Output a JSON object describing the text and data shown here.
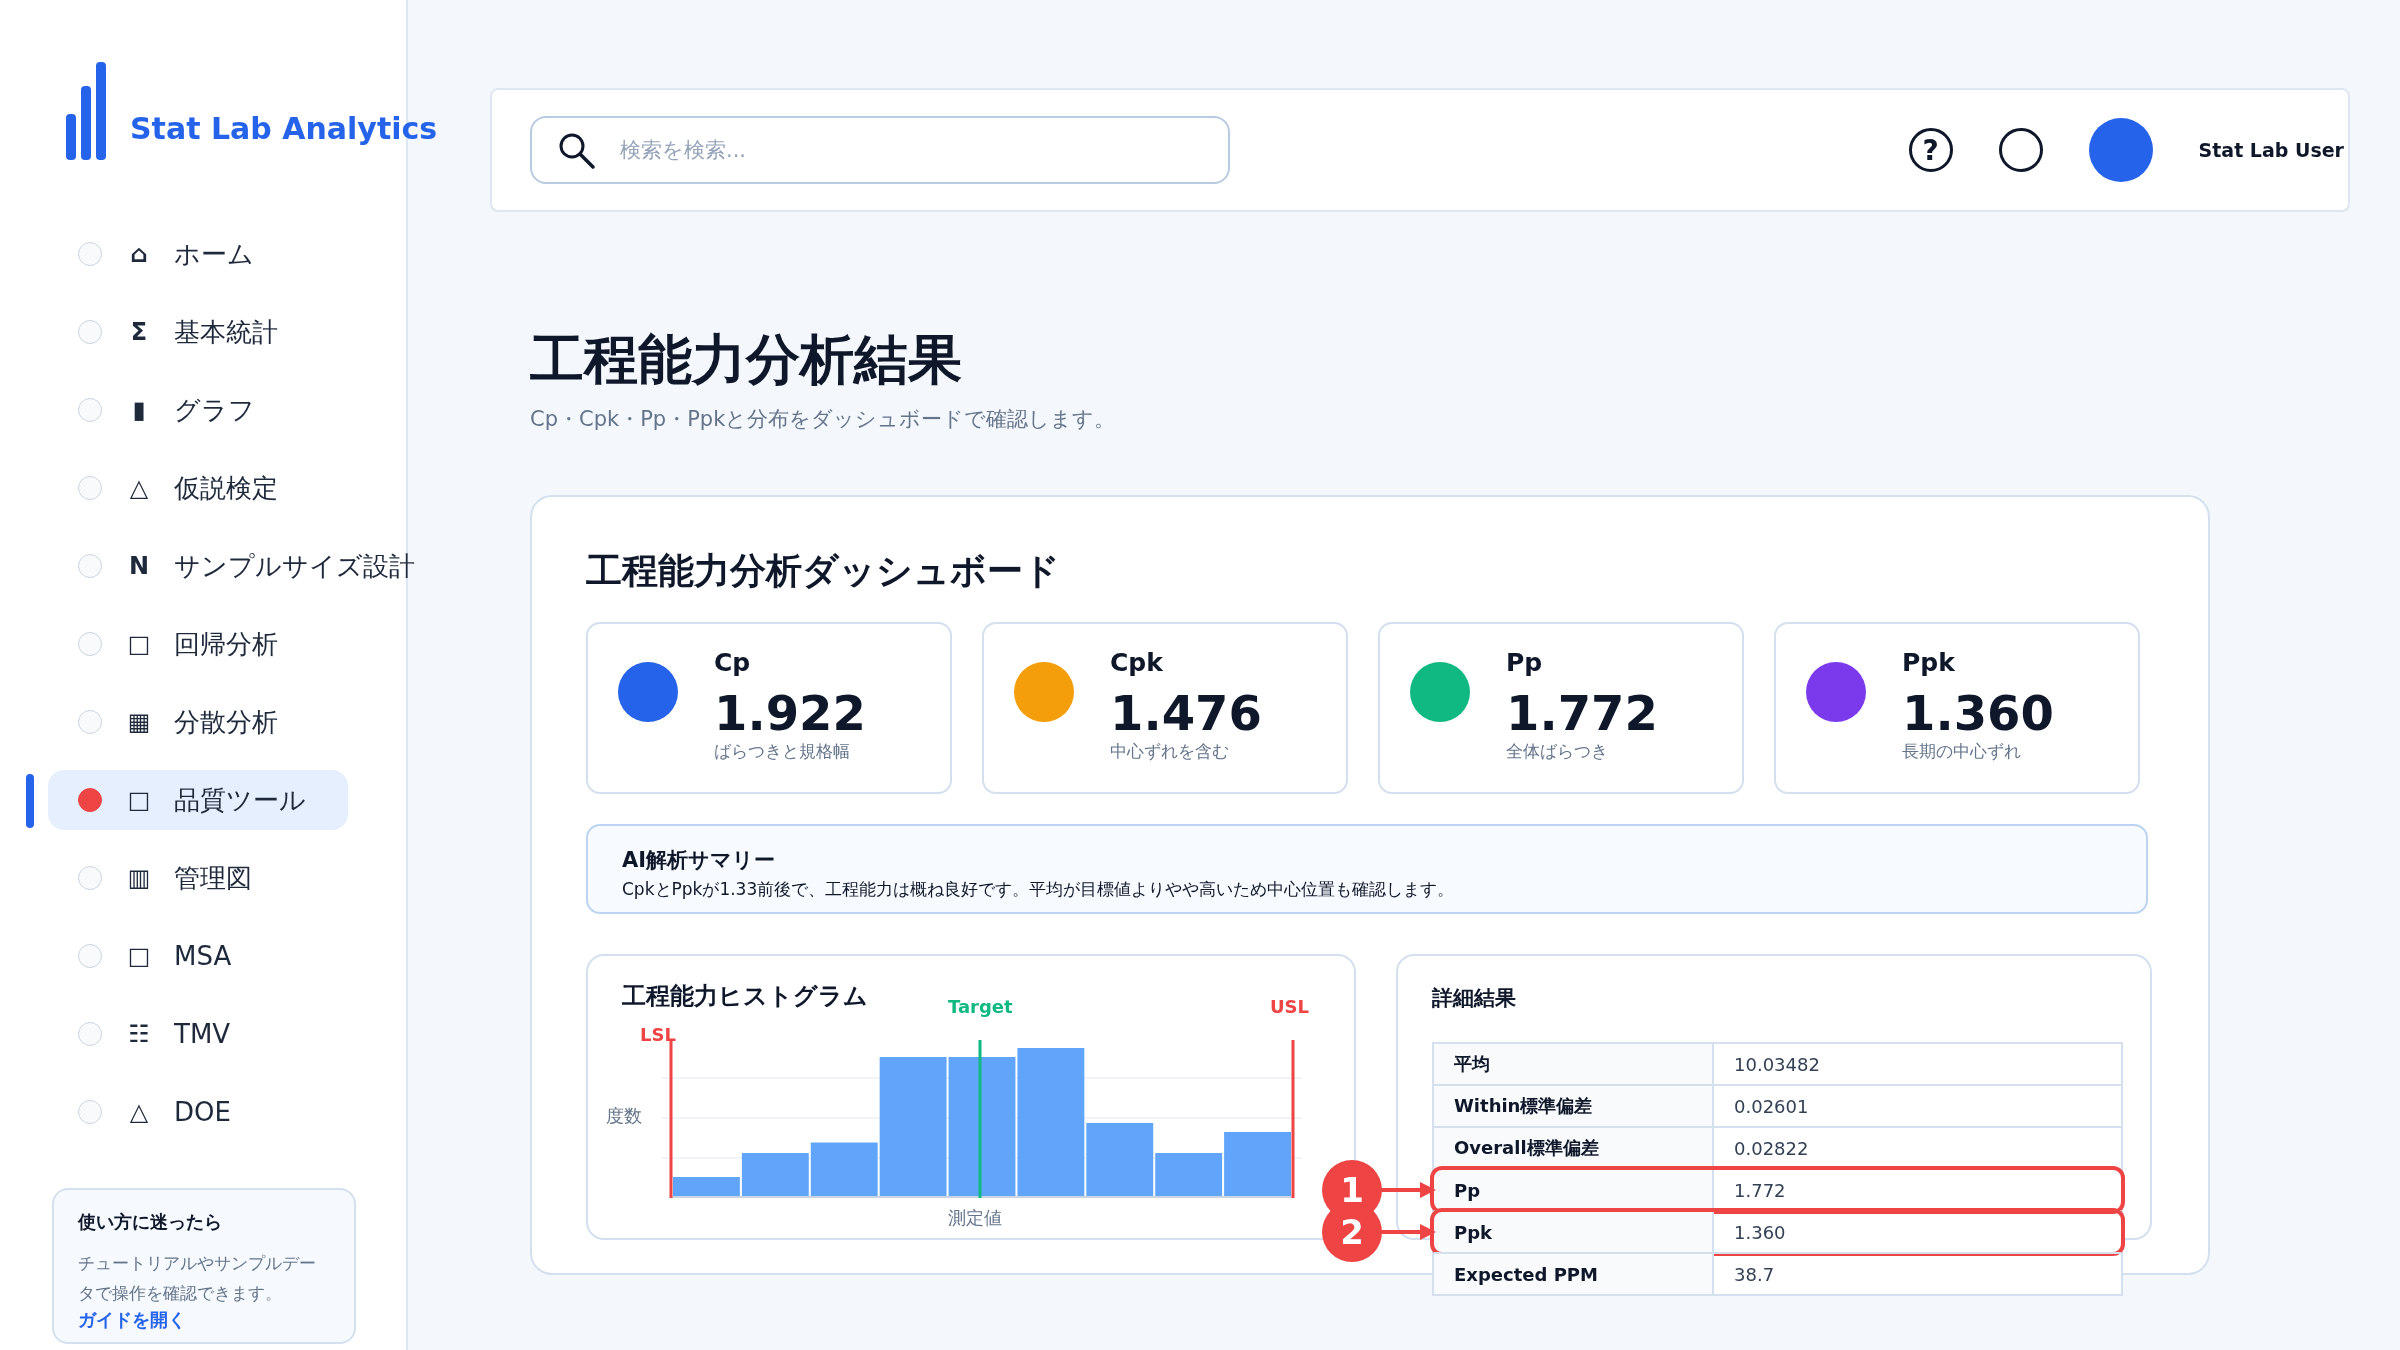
{
  "sidebar": {
    "logo_text": "Stat Lab Analytics",
    "items": [
      {
        "icon": "⌂",
        "label": "ホーム",
        "selected": false
      },
      {
        "icon": "Σ",
        "label": "基本統計",
        "selected": false
      },
      {
        "icon": "▮",
        "label": "グラフ",
        "selected": false
      },
      {
        "icon": "△",
        "label": "仮説検定",
        "selected": false
      },
      {
        "icon": "N",
        "label": "サンプルサイズ設計",
        "selected": false
      },
      {
        "icon": "□",
        "label": "回帰分析",
        "selected": false
      },
      {
        "icon": "▦",
        "label": "分散分析",
        "selected": false
      },
      {
        "icon": "□",
        "label": "品質ツール",
        "selected": true
      },
      {
        "icon": "▥",
        "label": "管理図",
        "selected": false
      },
      {
        "icon": "□",
        "label": "MSA",
        "selected": false
      },
      {
        "icon": "☷",
        "label": "TMV",
        "selected": false
      },
      {
        "icon": "△",
        "label": "DOE",
        "selected": false
      }
    ],
    "help_card": {
      "title": "使い方に迷ったら",
      "text": "チュートリアルやサンプルデータで操作を確認できます。",
      "link": "ガイドを開く"
    }
  },
  "header": {
    "search": {
      "placeholder": "検索を検索..."
    },
    "help_glyph": "?",
    "user_name": "Stat Lab User"
  },
  "page": {
    "title": "工程能力分析結果",
    "subtitle": "Cp・Cpk・Pp・Ppkと分布をダッシュボードで確認します。"
  },
  "dashboard": {
    "title": "工程能力分析ダッシュボード",
    "metrics": [
      {
        "label": "Cp",
        "value": "1.922",
        "caption": "ばらつきと規格幅",
        "color": "#2563eb"
      },
      {
        "label": "Cpk",
        "value": "1.476",
        "caption": "中心ずれを含む",
        "color": "#f59e0b"
      },
      {
        "label": "Pp",
        "value": "1.772",
        "caption": "全体ばらつき",
        "color": "#10b981"
      },
      {
        "label": "Ppk",
        "value": "1.360",
        "caption": "長期の中心ずれ",
        "color": "#7c3aed"
      }
    ],
    "summary": {
      "title": "AI解析サマリー",
      "text": "CpkとPpkが1.33前後で、工程能力は概ね良好です。平均が目標値よりやや高いため中心位置も確認します。"
    },
    "histogram": {
      "title": "工程能力ヒストグラム",
      "lsl_label": "LSL",
      "target_label": "Target",
      "usl_label": "USL",
      "ylabel": "度数",
      "xlabel": "測定値"
    },
    "details": {
      "title": "詳細結果",
      "rows": [
        {
          "label": "平均",
          "value": "10.03482",
          "highlighted": false
        },
        {
          "label": "Within標準偏差",
          "value": "0.02601",
          "highlighted": false
        },
        {
          "label": "Overall標準偏差",
          "value": "0.02822",
          "highlighted": false
        },
        {
          "label": "Pp",
          "value": "1.772",
          "highlighted": true,
          "callout": "1"
        },
        {
          "label": "Ppk",
          "value": "1.360",
          "highlighted": true,
          "callout": "2"
        },
        {
          "label": "Expected PPM",
          "value": "38.7",
          "highlighted": false
        }
      ]
    }
  }
}
